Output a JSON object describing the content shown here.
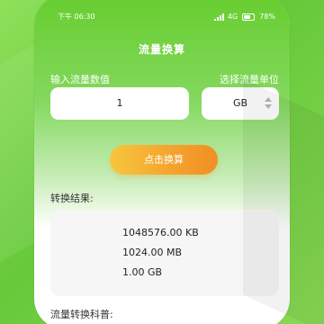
{
  "status_bar": {
    "time": "下午 06:30",
    "network": "4G",
    "battery": "78%"
  },
  "header": {
    "title": "流量换算"
  },
  "form": {
    "input_label": "输入流量数值",
    "input_value": "1",
    "unit_label": "选择流量单位",
    "unit_value": "GB"
  },
  "actions": {
    "calculate_label": "点击换算"
  },
  "results": {
    "title": "转换结果:",
    "lines": [
      "1048576.00 KB",
      "1024.00 MB",
      "1.00 GB"
    ]
  },
  "popular_science": {
    "title": "流量转换科普:"
  },
  "colors": {
    "primary_green": "#66cd2e",
    "button_orange": "#f4a22e",
    "card_bg": "#f6f6f6"
  }
}
